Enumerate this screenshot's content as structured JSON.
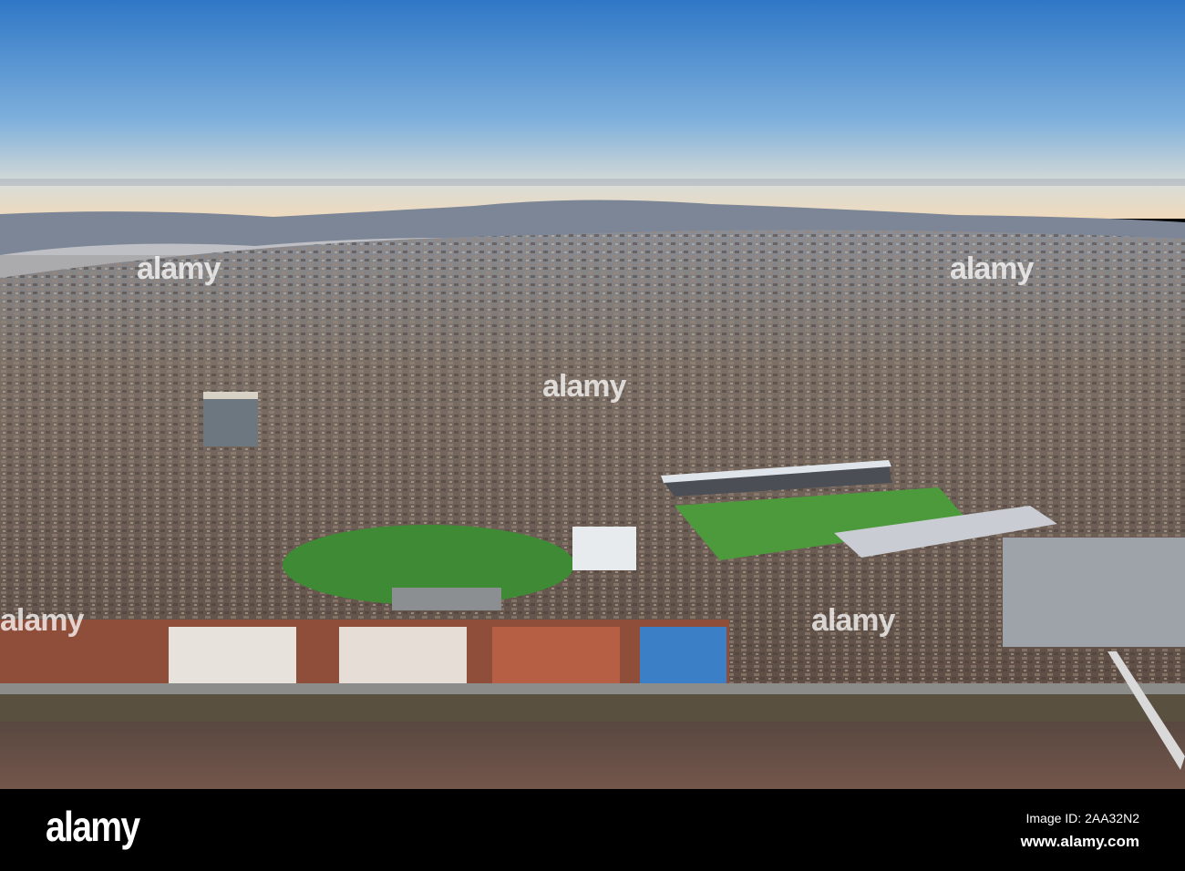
{
  "photo": {
    "subject": "aerial-city-stadium-river",
    "colors": {
      "sky_top": "#2f77c6",
      "sky_horizon": "#efdcc0",
      "city": "#6e6258",
      "pitch": "#3f8a35",
      "river": "#6d5148"
    }
  },
  "watermark": {
    "logo": "alamy"
  },
  "footer": {
    "logo": "alamy",
    "image_id": "Image ID: 2AA32N2",
    "url": "www.alamy.com"
  }
}
